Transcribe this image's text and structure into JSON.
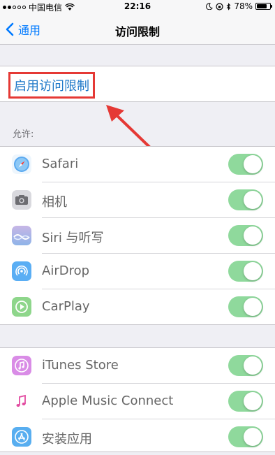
{
  "status_bar": {
    "carrier": "中国电信",
    "time": "22:16",
    "battery": "78%",
    "battery_level": 0.78
  },
  "nav": {
    "back_label": "通用",
    "title": "访问限制"
  },
  "enable_restrictions_label": "启用访问限制",
  "allow_header": "允许:",
  "group1": [
    {
      "label": "Safari",
      "icon": "safari-icon",
      "on": true
    },
    {
      "label": "相机",
      "icon": "camera-icon",
      "on": true
    },
    {
      "label": "Siri 与听写",
      "icon": "siri-icon",
      "on": true
    },
    {
      "label": "AirDrop",
      "icon": "airdrop-icon",
      "on": true
    },
    {
      "label": "CarPlay",
      "icon": "carplay-icon",
      "on": true
    }
  ],
  "group2": [
    {
      "label": "iTunes Store",
      "icon": "itunes-store-icon",
      "on": true
    },
    {
      "label": "Apple Music Connect",
      "icon": "music-note-icon",
      "on": true
    },
    {
      "label": "安装应用",
      "icon": "app-store-icon",
      "on": true
    }
  ],
  "colors": {
    "accent": "#007aff",
    "toggle_on": "#8fd99c",
    "highlight_border": "#e53935",
    "arrow": "#e53935"
  }
}
